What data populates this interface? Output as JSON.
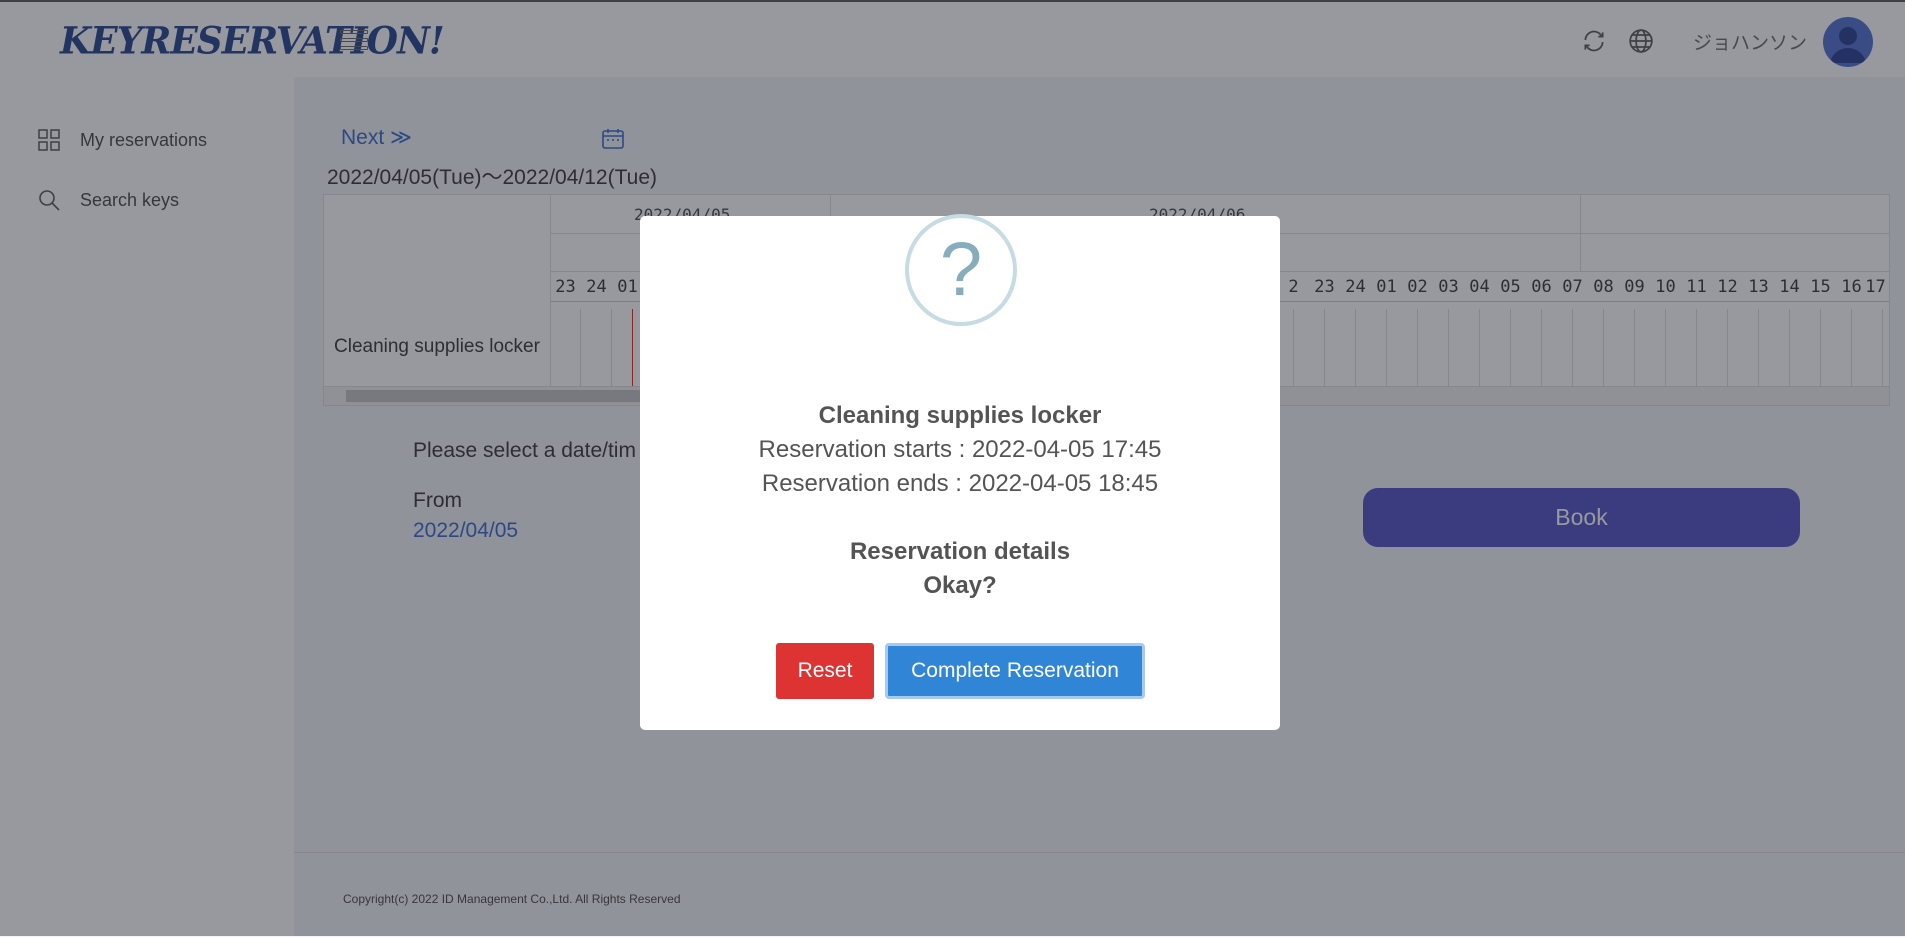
{
  "header": {
    "logo_main": "KEYRESERVATION",
    "logo_mark": "!",
    "username": "ジョハンソン",
    "icons": [
      "menu-icon",
      "refresh-icon",
      "globe-icon",
      "avatar"
    ]
  },
  "sidebar": {
    "items": [
      {
        "label": "My reservations",
        "icon": "grid-icon"
      },
      {
        "label": "Search keys",
        "icon": "search-icon"
      }
    ]
  },
  "main": {
    "next_label": "Next ≫",
    "date_range": "2022/04/05(Tue)〜2022/04/12(Tue)",
    "grid": {
      "dates": [
        "2022/04/05",
        "2022/04/06"
      ],
      "hours_left": [
        "23",
        "24",
        "01"
      ],
      "hours_right": [
        "2",
        "23",
        "24",
        "01",
        "02",
        "03",
        "04",
        "05",
        "06",
        "07",
        "08",
        "09",
        "10",
        "11",
        "12",
        "13",
        "14",
        "15",
        "16",
        "17"
      ],
      "row_label": "Cleaning supplies locker"
    },
    "prompt": "Please select a date/tim",
    "from_label": "From",
    "from_value": "2022/04/05",
    "book_label": "Book"
  },
  "footer": {
    "copyright": "Copyright(c) 2022 ID Management Co.,Ltd. All Rights Reserved"
  },
  "modal": {
    "icon": "?",
    "title": "Cleaning supplies locker",
    "start_line": "Reservation starts : 2022-04-05 17:45",
    "end_line": "Reservation ends : 2022-04-05 18:45",
    "details_heading": "Reservation details",
    "confirm_question": "Okay?",
    "reset_label": "Reset",
    "complete_label": "Complete Reservation"
  },
  "colors": {
    "accent_blue": "#2f66d0",
    "book_button": "#4b4dc4",
    "reset_button": "#dd3333",
    "confirm_button": "#3085d6"
  }
}
